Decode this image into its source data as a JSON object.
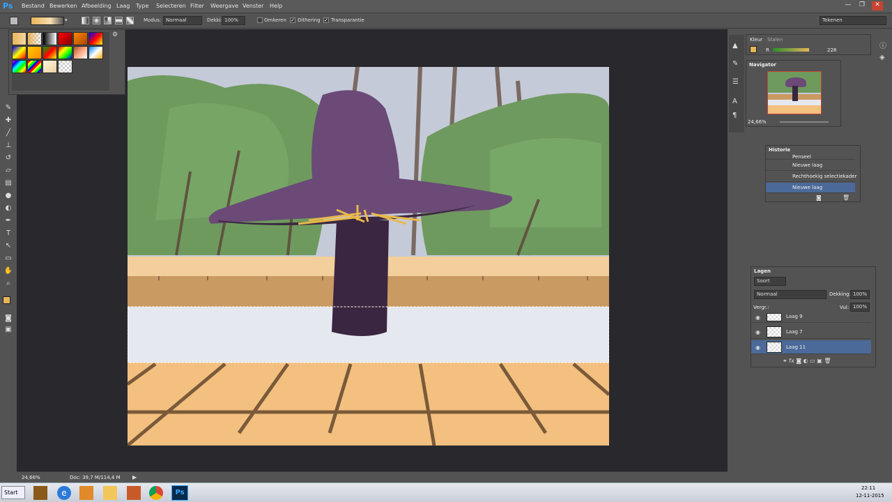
{
  "app": {
    "logo": "Ps"
  },
  "menu": [
    "Bestand",
    "Bewerken",
    "Afbeelding",
    "Laag",
    "Type",
    "Selecteren",
    "Filter",
    "Weergave",
    "Venster",
    "Help"
  ],
  "window_buttons": {
    "minimize": "—",
    "restore": "❐",
    "close": "✕"
  },
  "options": {
    "mode_label": "Modus:",
    "mode_value": "Normaal",
    "opacity_label": "Dekki:",
    "opacity_value": "100%",
    "reverse_label": "Omkeren",
    "dither_label": "Dithering",
    "transparency_label": "Transparantie",
    "workspace_value": "Tekenen"
  },
  "color_panel": {
    "tab1": "Kleur",
    "tab2": "Stalen",
    "channel": "R",
    "value": "228",
    "fg": "#e8b45a"
  },
  "navigator": {
    "title": "Navigator",
    "zoom": "24,66%"
  },
  "history": {
    "title": "Historie",
    "items": [
      "Penseel",
      "Nieuwe laag",
      "Rechthoekig selectiekader",
      "Nieuwe laag"
    ]
  },
  "layers": {
    "title": "Lagen",
    "filter": "Soort",
    "blend": "Normaal",
    "opacity_label": "Dekking:",
    "opacity_value": "100%",
    "lock_label": "Vergr.:",
    "fill_label": "Vul:",
    "fill_value": "100%",
    "items": [
      "Laag 9",
      "Laag 7",
      "Laag 11"
    ]
  },
  "status": {
    "zoom": "24,66%",
    "doc": "Doc: 39,7 M/114,4 M"
  },
  "taskbar": {
    "start": "Start",
    "time": "22:11",
    "date": "12-11-2015"
  },
  "colors": {
    "fg_swatch": "#e8b45a",
    "bg_swatch": "#ffffff",
    "selected_row": "#4b6a9a"
  }
}
